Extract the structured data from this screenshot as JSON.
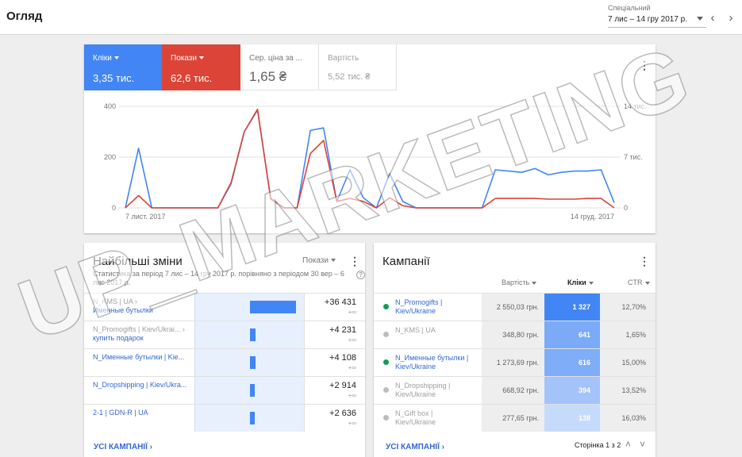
{
  "header": {
    "title": "Огляд",
    "date_label": "Спеціальний",
    "date_range": "7 лис – 14 гру 2017 р."
  },
  "metrics": [
    {
      "label": "Кліки",
      "value": "3,35 тис."
    },
    {
      "label": "Покази",
      "value": "62,6 тис."
    },
    {
      "label": "Сер. ціна за ...",
      "value": "1,65 ₴"
    },
    {
      "label": "Вартість",
      "value": "5,52 тис. ₴"
    }
  ],
  "chart_data": {
    "type": "line",
    "x_start_label": "7 лист. 2017",
    "x_end_label": "14 груд. 2017",
    "left_axis": {
      "ticks": [
        "0",
        "200",
        "400"
      ],
      "ylim": [
        0,
        400
      ]
    },
    "right_axis": {
      "ticks": [
        "0",
        "7 тис.",
        "14 тис."
      ],
      "ylim": [
        0,
        14000
      ]
    },
    "series": [
      {
        "name": "Кліки",
        "color": "#4285f4",
        "axis": "left",
        "values": [
          0,
          235,
          0,
          0,
          0,
          0,
          0,
          0,
          95,
          300,
          385,
          35,
          0,
          0,
          305,
          315,
          25,
          150,
          40,
          0,
          135,
          25,
          0,
          0,
          0,
          0,
          0,
          0,
          150,
          145,
          140,
          155,
          130,
          140,
          145,
          145,
          150,
          20
        ]
      },
      {
        "name": "Покази",
        "color": "#db4437",
        "axis": "right",
        "values": [
          0,
          1700,
          0,
          0,
          0,
          0,
          0,
          0,
          3500,
          10500,
          13600,
          1300,
          0,
          0,
          7500,
          9300,
          900,
          1300,
          900,
          0,
          1400,
          300,
          0,
          0,
          0,
          0,
          0,
          0,
          1300,
          1300,
          1300,
          1300,
          1200,
          1200,
          1200,
          1300,
          1300,
          0
        ]
      }
    ]
  },
  "changes": {
    "title": "Найбільші зміни",
    "subtitle": "Статистика за період 7 лис – 14 гру 2017 р. порівняно з періодом 30 вер – 6 лис 2017 р.",
    "metric_select": "Покази",
    "rows": [
      {
        "line1": "N_KMS | UA ›",
        "line2": "Именные бутылки",
        "value": "+36 431",
        "delta": "+∞",
        "ratio": 1.0
      },
      {
        "line1": "N_Promogifts | Kiev/Ukrai... ›",
        "line2": "купить подарок",
        "value": "+4 231",
        "delta": "+∞",
        "ratio": 0.116
      },
      {
        "line1": "N_Именные бутылки | Kie...",
        "line2": "",
        "value": "+4 108",
        "delta": "+∞",
        "ratio": 0.113
      },
      {
        "line1": "N_Dropshipping | Kiev/Ukra...",
        "line2": "",
        "value": "+2 914",
        "delta": "+∞",
        "ratio": 0.08
      },
      {
        "line1": "2-1 | GDN-R | UA",
        "line2": "",
        "value": "+2 636",
        "delta": "+∞",
        "ratio": 0.072
      }
    ],
    "footer_link": "УСІ КАМПАНІЇ"
  },
  "campaigns": {
    "title": "Кампанії",
    "headers": {
      "cost": "Вартість",
      "clicks": "Кліки",
      "ctr": "CTR"
    },
    "rows": [
      {
        "name": "N_Promogifts | Kiev/Ukraine",
        "active": true,
        "cost": "2 550,03 грн.",
        "clicks": "1 327",
        "ctr": "12,70%",
        "shade": "#4285f4"
      },
      {
        "name": "N_KMS | UA",
        "active": false,
        "cost": "348,80 грн.",
        "clicks": "641",
        "ctr": "1,65%",
        "shade": "#7baaf7"
      },
      {
        "name": "N_Именные бутылки | Kiev/Ukraine",
        "active": true,
        "cost": "1 273,69 грн.",
        "clicks": "616",
        "ctr": "15,00%",
        "shade": "#7fadf7"
      },
      {
        "name": "N_Dropshipping | Kiev/Ukraine",
        "active": false,
        "cost": "668,92 грн.",
        "clicks": "394",
        "ctr": "13,52%",
        "shade": "#a4c3f9"
      },
      {
        "name": "N_Gift box | Kiev/Ukraine",
        "active": false,
        "cost": "277,65 грн.",
        "clicks": "138",
        "ctr": "16,03%",
        "shade": "#c6dafc"
      }
    ],
    "footer_link": "УСІ КАМПАНІЇ",
    "pager": "Сторінка 1 з 2"
  },
  "watermark": "UP_MARKETING",
  "colors": {
    "clicks": "#4285f4",
    "impressions": "#db4437",
    "link": "#3367d6"
  }
}
